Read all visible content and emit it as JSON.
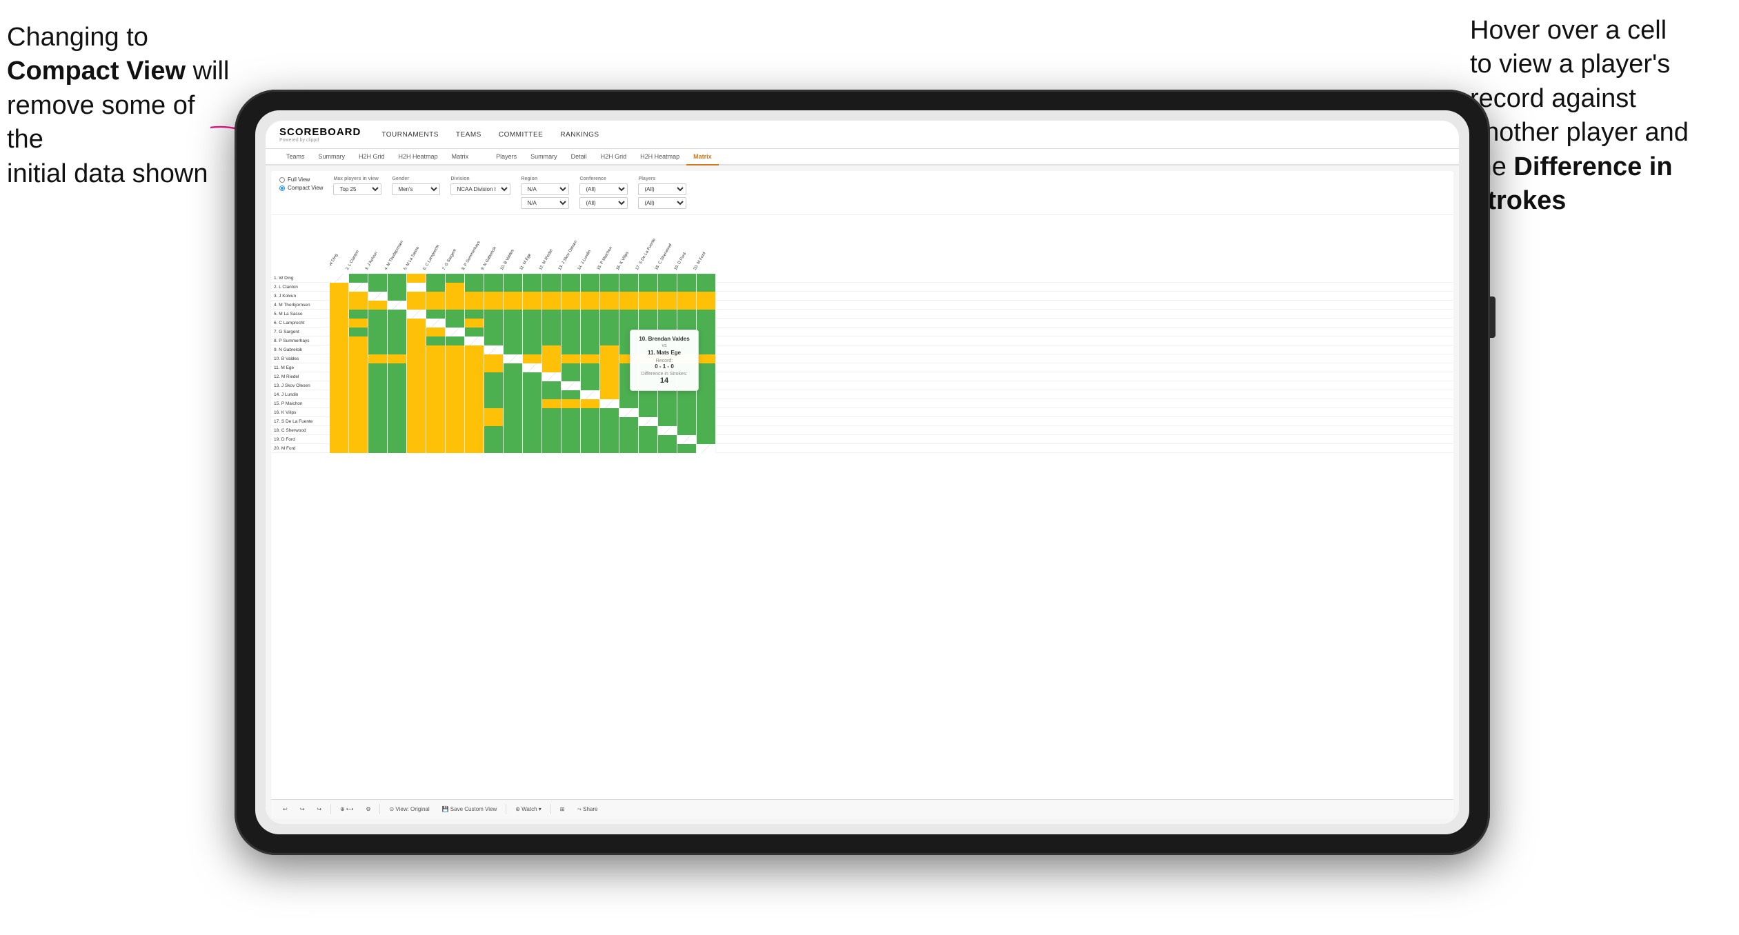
{
  "annotations": {
    "left": {
      "line1": "Changing to",
      "line2_plain": "",
      "line2_bold": "Compact View",
      "line2_suffix": " will",
      "line3": "remove some of the",
      "line4": "initial data shown"
    },
    "right": {
      "line1": "Hover over a cell",
      "line2": "to view a player's",
      "line3": "record against",
      "line4": "another player and",
      "line5_plain": "the ",
      "line5_bold": "Difference in",
      "line6": "Strokes"
    }
  },
  "nav": {
    "logo": "SCOREBOARD",
    "logo_sub": "Powered by clippd",
    "links": [
      "TOURNAMENTS",
      "TEAMS",
      "COMMITTEE",
      "RANKINGS"
    ]
  },
  "sub_tabs": {
    "group1": [
      "Teams",
      "Summary",
      "H2H Grid",
      "H2H Heatmap",
      "Matrix"
    ],
    "group2": [
      "Players",
      "Summary",
      "Detail",
      "H2H Grid",
      "H2H Heatmap",
      "Matrix"
    ],
    "active": "Matrix"
  },
  "filters": {
    "view_full": "Full View",
    "view_compact": "Compact View",
    "max_players_label": "Max players in view",
    "max_players_value": "Top 25",
    "gender_label": "Gender",
    "gender_value": "Men's",
    "division_label": "Division",
    "division_value": "NCAA Division I",
    "region_label": "Region",
    "region_value1": "N/A",
    "region_value2": "N/A",
    "conference_label": "Conference",
    "conference_value1": "(All)",
    "conference_value2": "(All)",
    "players_label": "Players",
    "players_value1": "(All)",
    "players_value2": "(All)"
  },
  "column_headers": [
    "1. W Ding",
    "2. L Clanton",
    "3. J Kolvun",
    "4. M Thorbjornsen",
    "5. M La Sasso",
    "6. C Lamprecht",
    "7. G Sargent",
    "8. P Summerhays",
    "9. N Gabrelcik",
    "10. B Valdes",
    "11. M Ege",
    "12. M Riedel",
    "13. J Skov Olesen",
    "14. J Lundin",
    "15. P Maichon",
    "16. K Vilips",
    "17. S De La Fuente",
    "18. C Sherwood",
    "19. D Ford",
    "20. M Ford"
  ],
  "players": [
    "1. W Ding",
    "2. L Clanton",
    "3. J Kolvun",
    "4. M Thorbjornsen",
    "5. M La Sasso",
    "6. C Lamprecht",
    "7. G Sargent",
    "8. P Summerhays",
    "9. N Gabrelcik",
    "10. B Valdes",
    "11. M Ege",
    "12. M Riedel",
    "13. J Skov Olesen",
    "14. J Lundin",
    "15. P Maichon",
    "16. K Vilips",
    "17. S De La Fuente",
    "18. C Sherwood",
    "19. D Ford",
    "20. M Ford"
  ],
  "tooltip": {
    "player1": "10. Brendan Valdes",
    "vs": "vs",
    "player2": "11. Mats Ege",
    "record_label": "Record:",
    "record": "0 - 1 - 0",
    "diff_label": "Difference in Strokes:",
    "diff_value": "14"
  },
  "toolbar": {
    "undo": "↩",
    "redo": "↪",
    "zoom_in": "+",
    "zoom_out": "−",
    "view_original": "⊙ View: Original",
    "save_custom": "💾 Save Custom View",
    "watch": "⊛ Watch ▾",
    "share": "⤳ Share"
  },
  "colors": {
    "green": "#4caf50",
    "yellow": "#ffc107",
    "gray": "#bdbdbd",
    "active_tab": "#d4781a",
    "brand": "#000000"
  }
}
